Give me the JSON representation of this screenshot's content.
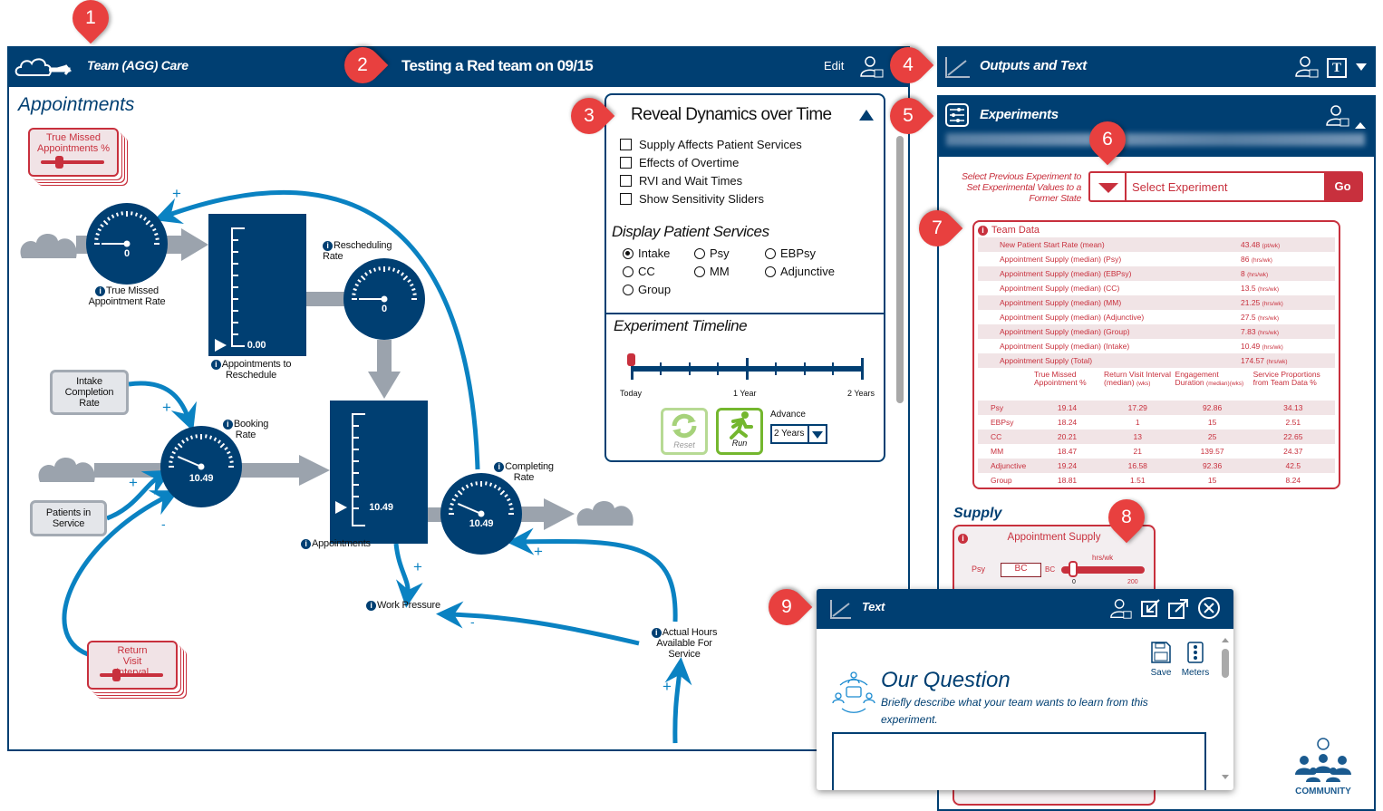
{
  "left_panel": {
    "logo_label": "Team (AGG) Care",
    "title": "Testing a Red team on 09/15",
    "edit_label": "Edit",
    "section_title": "Appointments",
    "true_missed_card": "True Missed Appointments %",
    "return_visit_card": "Return Visit Interval",
    "intake_box": "Intake Completion Rate",
    "patients_box": "Patients in Service",
    "gauges": {
      "true_missed": {
        "label": "True Missed Appointment Rate",
        "value": "0",
        "fraction": 0
      },
      "rescheduling": {
        "label": "Rescheduling Rate",
        "value": "0",
        "fraction": 0
      },
      "booking": {
        "label": "Booking Rate",
        "value": "10.49",
        "fraction": 0.05
      },
      "completing": {
        "label": "Completing Rate",
        "value": "10.49",
        "fraction": 0.05
      }
    },
    "stocks": {
      "reschedule": {
        "label": "Appointments to Reschedule",
        "value": "0.00"
      },
      "appointments": {
        "label": "Appointments",
        "value": "10.49"
      }
    },
    "work_pressure": "Work Pressure",
    "actual_hours": "Actual Hours Available For Service",
    "signs": {
      "plus": "+",
      "minus": "-"
    }
  },
  "reveal_panel": {
    "title": "Reveal Dynamics over Time",
    "checkboxes": [
      {
        "label": "Supply Affects Patient Services",
        "checked": false
      },
      {
        "label": "Effects of Overtime",
        "checked": false
      },
      {
        "label": "RVI and Wait Times",
        "checked": false
      },
      {
        "label": "Show Sensitivity Sliders",
        "checked": false
      }
    ],
    "display_title": "Display Patient Services",
    "radios": [
      {
        "label": "Intake",
        "selected": true
      },
      {
        "label": "Psy",
        "selected": false
      },
      {
        "label": "EBPsy",
        "selected": false
      },
      {
        "label": "CC",
        "selected": false
      },
      {
        "label": "MM",
        "selected": false
      },
      {
        "label": "Adjunctive",
        "selected": false
      },
      {
        "label": "Group",
        "selected": false
      }
    ],
    "timeline_title": "Experiment Timeline",
    "timeline_labels": [
      "Today",
      "1 Year",
      "2 Years"
    ],
    "timeline_progress": 0,
    "reset_label": "Reset",
    "run_label": "Run",
    "advance_label": "Advance",
    "advance_value": "2 Years"
  },
  "outputs_panel": {
    "title": "Outputs and Text"
  },
  "experiments_panel": {
    "title": "Experiments",
    "select_hint": "Select Previous Experiment to Set Experimental Values to a Former State",
    "select_placeholder": "Select Experiment",
    "go_label": "Go",
    "team_data": {
      "title": "Team Data",
      "rows": [
        {
          "label": "New Patient Start Rate (mean)",
          "value": "43.48",
          "unit": "(pt/wk)"
        },
        {
          "label": "Appointment Supply (median) (Psy)",
          "value": "86",
          "unit": "(hrs/wk)"
        },
        {
          "label": "Appointment Supply (median) (EBPsy)",
          "value": "8",
          "unit": "(hrs/wk)"
        },
        {
          "label": "Appointment Supply (median) (CC)",
          "value": "13.5",
          "unit": "(hrs/wk)"
        },
        {
          "label": "Appointment Supply (median) (MM)",
          "value": "21.25",
          "unit": "(hrs/wk)"
        },
        {
          "label": "Appointment Supply (median) (Adjunctive)",
          "value": "27.5",
          "unit": "(hrs/wk)"
        },
        {
          "label": "Appointment Supply (median) (Group)",
          "value": "7.83",
          "unit": "(hrs/wk)"
        },
        {
          "label": "Appointment Supply (median) (Intake)",
          "value": "10.49",
          "unit": "(hrs/wk)"
        },
        {
          "label": "Appointment Supply (Total)",
          "value": "174.57",
          "unit": "(hrs/wk)"
        }
      ],
      "columns": [
        "True Missed Appointment %",
        "Return Visit Interval (median)",
        "Engagement Duration",
        "Service Proportions from Team Data %"
      ],
      "column_units": [
        "",
        "(wks)",
        "(median)(wks)",
        ""
      ],
      "services": [
        {
          "name": "Psy",
          "values": [
            "19.14",
            "17.29",
            "92.86",
            "34.13"
          ]
        },
        {
          "name": "EBPsy",
          "values": [
            "18.24",
            "1",
            "15",
            "2.51"
          ]
        },
        {
          "name": "CC",
          "values": [
            "20.21",
            "13",
            "25",
            "22.65"
          ]
        },
        {
          "name": "MM",
          "values": [
            "18.47",
            "21",
            "139.57",
            "24.37"
          ]
        },
        {
          "name": "Adjunctive",
          "values": [
            "19.24",
            "16.58",
            "92.36",
            "42.5"
          ]
        },
        {
          "name": "Group",
          "values": [
            "18.81",
            "1.51",
            "15",
            "8.24"
          ]
        }
      ]
    },
    "supply": {
      "title": "Supply",
      "card_title": "Appointment Supply",
      "unit": "hrs/wk",
      "row_label": "Psy",
      "input_value": "BC",
      "bc_label": "BC",
      "min": "0",
      "max": "200",
      "slider_fraction": 0
    }
  },
  "text_popup": {
    "title": "Text",
    "save_label": "Save",
    "meters_label": "Meters",
    "question_title": "Our Question",
    "question_prompt": "Briefly describe what your team wants to learn from this experiment.",
    "answer_value": ""
  },
  "community_label": "COMMUNITY",
  "callouts": [
    "1",
    "2",
    "3",
    "4",
    "5",
    "6",
    "7",
    "8",
    "9"
  ],
  "colors": {
    "navy": "#003f72",
    "red": "#c8303d",
    "blue_link": "#0a82c2",
    "callout": "#e8403f",
    "green": "#74b72e"
  }
}
